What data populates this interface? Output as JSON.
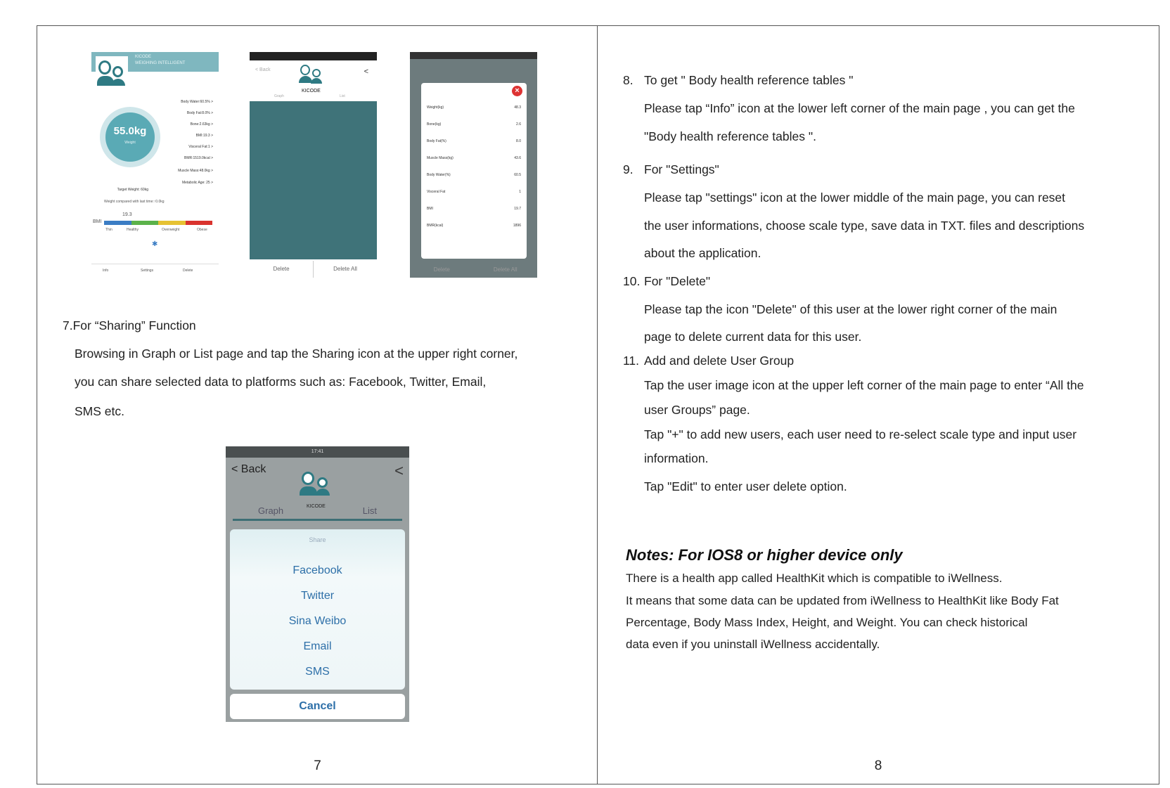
{
  "left_page": {
    "page_number": "7",
    "shot1": {
      "header_line1": "KICODE",
      "header_line2": "WEIGHING INTELLIGENT",
      "weight": "55.0kg",
      "weight_label": "Weight",
      "metrics": [
        "Body Water:60.5% >",
        "Body Fat:8.0% >",
        "Bone:2.63kg >",
        "BMI:19.3 >",
        "Visceral Fat:1 >",
        "BMR:1519.0kcal >",
        "Muscle Mass:48.0kg >",
        "Metabolic Age: 25 >"
      ],
      "target_weight": "Target Weight: 60kg",
      "compare": "Weight compared with last time:↑0.0kg",
      "bmi_value": "19.3",
      "bmi_label": "BMI",
      "bmi_scale": [
        "Thin",
        "Healthy",
        "Overweight",
        "Obese"
      ],
      "footer": [
        "Info",
        "Settings",
        "Delete"
      ]
    },
    "shot2": {
      "back": "< Back",
      "kicode": "KICODE",
      "tab_graph": "Graph",
      "tab_list": "List",
      "btn_delete": "Delete",
      "btn_delete_all": "Delete All"
    },
    "shot3": {
      "rows": [
        [
          "Weight(kg)",
          "48.3"
        ],
        [
          "Bone(kg)",
          "2.6"
        ],
        [
          "Body Fat(%)",
          "8.0"
        ],
        [
          "Muscle Mass(kg)",
          "43.6"
        ],
        [
          "Body Water(%)",
          "60.5"
        ],
        [
          "Visceral Fat",
          "1"
        ],
        [
          "BMI",
          "19.7"
        ],
        [
          "BMR(kcal)",
          "1896"
        ]
      ],
      "btn_delete": "Delete",
      "btn_delete_all": "Delete All"
    },
    "section7": {
      "heading": "7.For “Sharing” Function",
      "lines": [
        "Browsing in Graph or List page and tap the Sharing icon at the upper right corner,",
        "you can share selected data to platforms such as: Facebook, Twitter, Email,",
        "SMS etc."
      ]
    },
    "shot4": {
      "status": "17:41",
      "back": "< Back",
      "kicode": "KICODE",
      "tab_graph": "Graph",
      "tab_list": "List",
      "sheet_title": "Share",
      "options": [
        "Facebook",
        "Twitter",
        "Sina Weibo",
        "Email",
        "SMS"
      ],
      "cancel": "Cancel"
    }
  },
  "right_page": {
    "page_number": "8",
    "items": [
      {
        "num": "8.",
        "title": "To get \" Body health reference tables \"",
        "lines": [
          "Please tap “Info” icon at the lower left corner of the main page , you can get the",
          "\"Body health reference tables \"."
        ]
      },
      {
        "num": "9.",
        "title": "For \"Settings\"",
        "lines": [
          "Please tap \"settings\" icon at the lower middle of the main page, you can reset",
          "the user informations, choose scale type, save data in TXT. files and descriptions",
          "about the application."
        ]
      },
      {
        "num": "10.",
        "title": "For \"Delete\"",
        "lines": [
          "Please tap the icon \"Delete\" of this user at the lower right corner of the main",
          "page to delete current data for this user."
        ]
      },
      {
        "num": "11.",
        "title": "Add and delete User Group",
        "lines": [
          "Tap the user image icon at the upper left corner of the main page to enter “All the",
          "user Groups” page.",
          "Tap \"+\" to add new users, each user need to re-select scale type and input user",
          "information.",
          "Tap \"Edit\" to enter user delete option."
        ]
      }
    ],
    "notes_title": "Notes: For IOS8 or higher device only",
    "notes_lines": [
      "There is a health app called HealthKit which is compatible to iWellness.",
      "It means that some data can be updated from iWellness to HealthKit like Body Fat",
      "Percentage, Body Mass Index, Height,  and Weight. You can check historical",
      "data even if you uninstall iWellness accidentally."
    ]
  }
}
